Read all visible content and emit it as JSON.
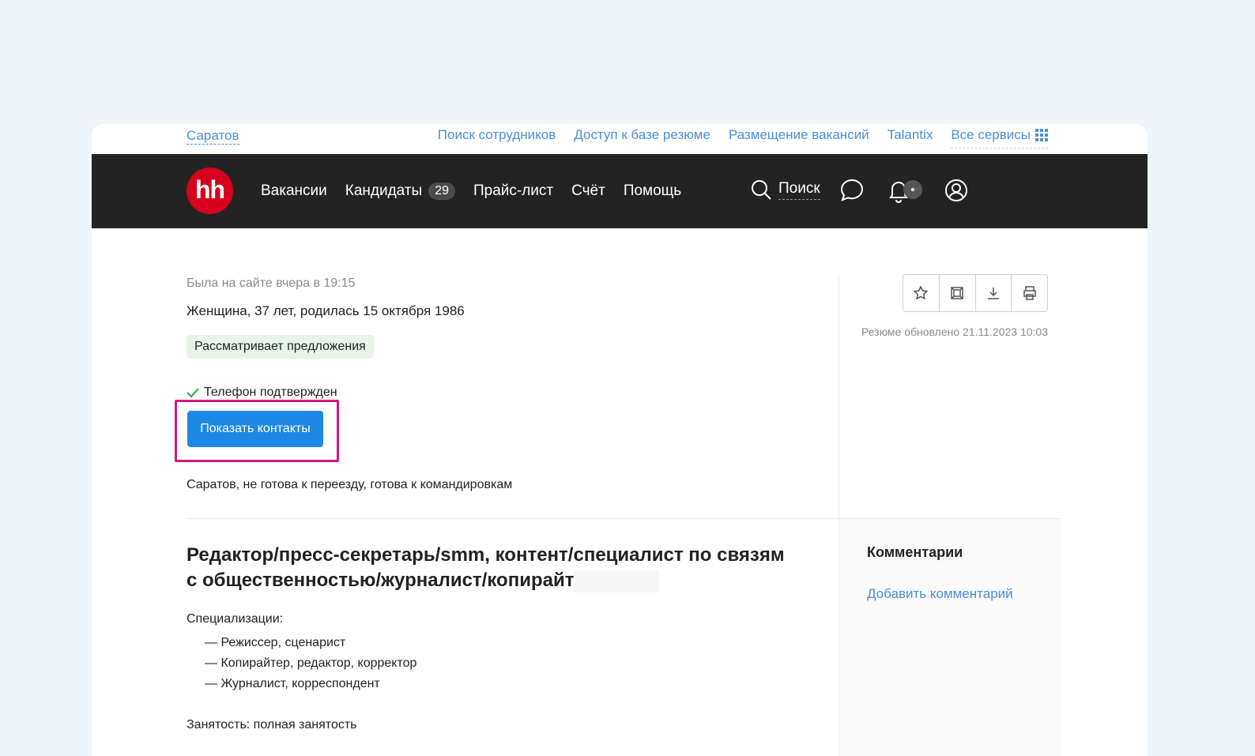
{
  "top_bar": {
    "city": "Саратов",
    "links": [
      "Поиск сотрудников",
      "Доступ к базе резюме",
      "Размещение вакансий",
      "Talantix"
    ],
    "all_services": "Все сервисы"
  },
  "header": {
    "logo_text": "hh",
    "nav": [
      {
        "label": "Вакансии"
      },
      {
        "label": "Кандидаты",
        "badge": "29"
      },
      {
        "label": "Прайс-лист"
      },
      {
        "label": "Счёт"
      },
      {
        "label": "Помощь"
      }
    ],
    "search_label": "Поиск",
    "icons": [
      "search-icon",
      "chat-icon",
      "bell-icon",
      "profile-icon"
    ]
  },
  "resume": {
    "last_seen": "Была на сайте вчера в 19:15",
    "demographics": "Женщина, 37 лет, родилась 15 октября 1986",
    "status": "Рассматривает предложения",
    "phone_verified": "Телефон подтвержден",
    "show_contacts": "Показать контакты",
    "location": "Саратов, не готова к переезду, готова к командировкам",
    "title": "Редактор/пресс-секретарь/smm, контент/специалист по связям с общественностью/журналист/копирайт",
    "specializations_label": "Специализации:",
    "specializations": [
      "— Режиссер, сценарист",
      "— Копирайтер, редактор, корректор",
      "— Журналист, корреспондент"
    ],
    "employment": "Занятость: полная занятость"
  },
  "sidebar": {
    "tools": [
      "star-icon",
      "template-icon",
      "download-icon",
      "print-icon"
    ],
    "updated": "Резюме обновлено 21.11.2023 10:03",
    "comments_title": "Комментарии",
    "add_comment": "Добавить комментарий"
  },
  "colors": {
    "brand_red": "#d6001c",
    "link_blue": "#4a8fd6",
    "button_blue": "#1e88e5",
    "highlight": "#d1197f"
  }
}
